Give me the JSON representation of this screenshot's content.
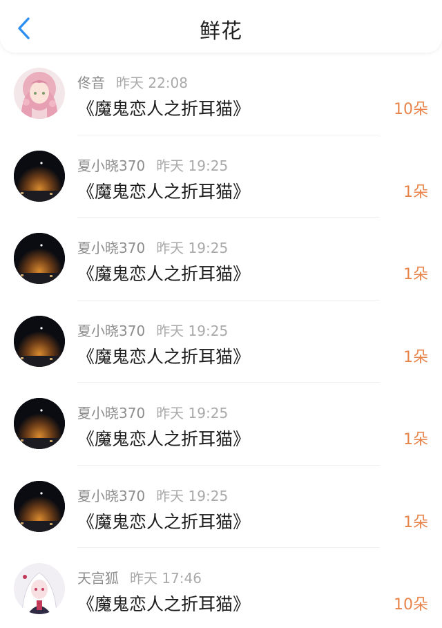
{
  "header": {
    "title": "鲜花",
    "back_icon": "chevron-left-icon",
    "accent_color": "#2d8ff0"
  },
  "colors": {
    "count": "#e8834a",
    "username": "#8d8d8d",
    "time": "#a9a9a9",
    "book": "#1b1b1b"
  },
  "items": [
    {
      "user": "佟音",
      "time": "昨天 22:08",
      "book": "《魔鬼恋人之折耳猫》",
      "count": "10朵",
      "avatar": "anime-girl-pink-hair-avatar"
    },
    {
      "user": "夏小晓370",
      "time": "昨天 19:25",
      "book": "《魔鬼恋人之折耳猫》",
      "count": "1朵",
      "avatar": "night-sky-avatar"
    },
    {
      "user": "夏小晓370",
      "time": "昨天 19:25",
      "book": "《魔鬼恋人之折耳猫》",
      "count": "1朵",
      "avatar": "night-sky-avatar"
    },
    {
      "user": "夏小晓370",
      "time": "昨天 19:25",
      "book": "《魔鬼恋人之折耳猫》",
      "count": "1朵",
      "avatar": "night-sky-avatar"
    },
    {
      "user": "夏小晓370",
      "time": "昨天 19:25",
      "book": "《魔鬼恋人之折耳猫》",
      "count": "1朵",
      "avatar": "night-sky-avatar"
    },
    {
      "user": "夏小晓370",
      "time": "昨天 19:25",
      "book": "《魔鬼恋人之折耳猫》",
      "count": "1朵",
      "avatar": "night-sky-avatar"
    },
    {
      "user": "天宫狐",
      "time": "昨天 17:46",
      "book": "《魔鬼恋人之折耳猫》",
      "count": "10朵",
      "avatar": "anime-white-hair-avatar"
    }
  ]
}
